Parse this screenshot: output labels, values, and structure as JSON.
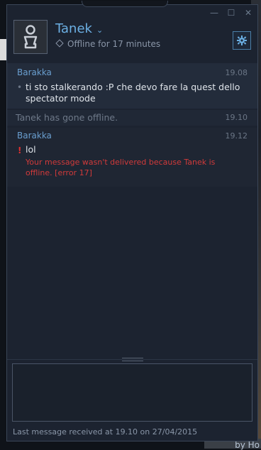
{
  "window": {
    "controls": {
      "minimize": "—",
      "maximize": "☐",
      "close": "✕"
    }
  },
  "header": {
    "friend_name": "Tanek",
    "status": "Offline for 17 minutes"
  },
  "messages": [
    {
      "sender": "Barakka",
      "time": "19.08",
      "text": "ti sto stalkerando :P che devo fare la quest dello spectator mode"
    },
    {
      "system": "Tanek has gone offline.",
      "time": "19.10"
    },
    {
      "sender": "Barakka",
      "time": "19.12",
      "text": "lol",
      "error": "Your message wasn't delivered because Tanek is offline. [error 17]"
    }
  ],
  "footer": {
    "last_message": "Last message received at 19.10 on 27/04/2015"
  },
  "background": {
    "bottom_right_text": "by Ho"
  },
  "colors": {
    "accent": "#6cb0e4",
    "error": "#d13a3a",
    "window_bg": "#1c2330"
  }
}
